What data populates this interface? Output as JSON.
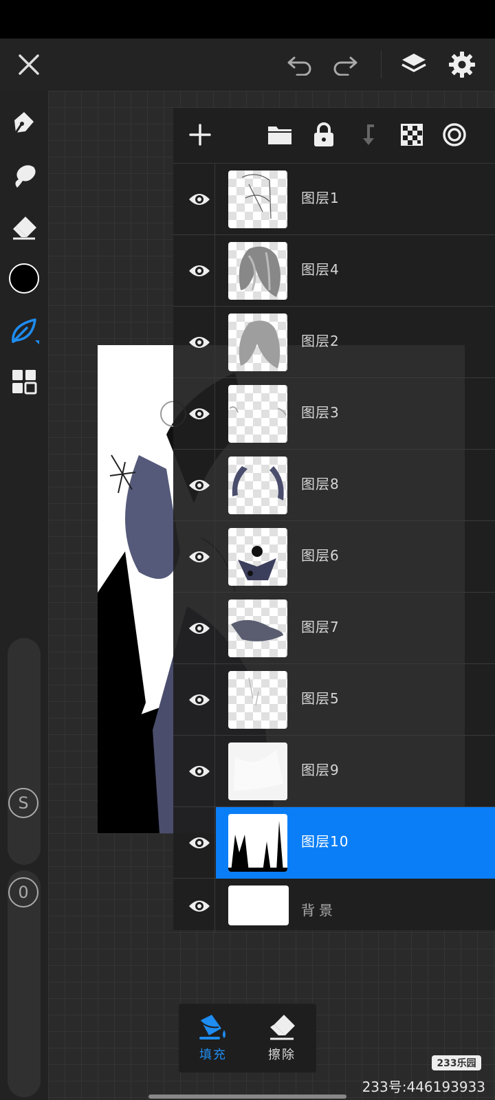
{
  "colors": {
    "accent": "#0a7ef7",
    "background": "#262626",
    "panel": "#1e1e1e"
  },
  "topbar": {
    "close_icon": "close-icon",
    "undo_icon": "undo-icon",
    "redo_icon": "redo-icon",
    "layers_icon": "layers-icon",
    "settings_icon": "gear-icon"
  },
  "left_tools": {
    "items": [
      "pen-icon",
      "smudge-icon",
      "eraser-icon",
      "color-swatch",
      "fill-lasso-icon",
      "grid-icon"
    ],
    "active_color": "#000000",
    "size_label": "S",
    "opacity_label": "0"
  },
  "layers_toolbar": {
    "items": [
      "add-icon",
      "folder-icon",
      "lock-icon",
      "merge-down-icon",
      "transparency-icon",
      "target-icon"
    ]
  },
  "layers": [
    {
      "name": "图层1",
      "visible": true,
      "selected": false
    },
    {
      "name": "图层4",
      "visible": true,
      "selected": false
    },
    {
      "name": "图层2",
      "visible": true,
      "selected": false
    },
    {
      "name": "图层3",
      "visible": true,
      "selected": false
    },
    {
      "name": "图层8",
      "visible": true,
      "selected": false
    },
    {
      "name": "图层6",
      "visible": true,
      "selected": false
    },
    {
      "name": "图层7",
      "visible": true,
      "selected": false
    },
    {
      "name": "图层5",
      "visible": true,
      "selected": false
    },
    {
      "name": "图层9",
      "visible": true,
      "selected": false
    },
    {
      "name": "图层10",
      "visible": true,
      "selected": true
    },
    {
      "name": "背景",
      "visible": true,
      "selected": false
    }
  ],
  "bottom_tools": {
    "fill_label": "填充",
    "erase_label": "擦除"
  },
  "watermark": {
    "badge": "233乐园",
    "text": "233号:446193933"
  }
}
